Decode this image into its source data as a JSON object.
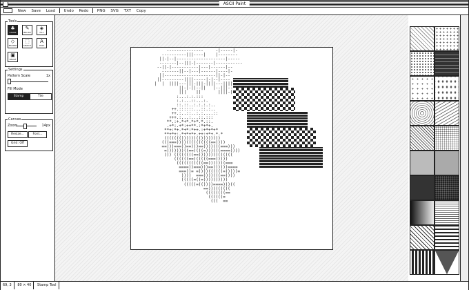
{
  "app": {
    "title": "ASCII Paint"
  },
  "menu": {
    "items": [
      "New",
      "Save",
      "Load",
      "Undo",
      "Redo",
      "PNG",
      "SVG",
      "TXT",
      "Copy"
    ]
  },
  "tools": {
    "label": "Tools",
    "items": [
      {
        "label": "STAMP",
        "icon": "stamp-icon",
        "glyph": "♣",
        "active": true
      },
      {
        "label": "BRUSH",
        "icon": "brush-icon",
        "glyph": "✎",
        "active": false
      },
      {
        "label": "FILL",
        "icon": "fill-icon",
        "glyph": "◈",
        "active": false
      },
      {
        "label": "ERASER",
        "icon": "eraser-icon",
        "glyph": "◇",
        "active": false
      },
      {
        "label": "SELECT",
        "icon": "select-icon",
        "glyph": "⬚",
        "active": false
      },
      {
        "label": "TEXT",
        "icon": "text-icon",
        "glyph": "A",
        "active": false
      },
      {
        "label": "IMAGE",
        "icon": "image-icon",
        "glyph": "▣",
        "active": false
      }
    ]
  },
  "settings": {
    "label": "Settings",
    "pattern_scale_label": "Pattern Scale",
    "pattern_scale_value": "1x",
    "fill_mode_label": "Fill Mode",
    "stamp_label": "Stamp",
    "tile_label": "Tile",
    "fill_mode": "Stamp"
  },
  "canvas": {
    "label": "Canvas",
    "zoom_label": "Zoom",
    "zoom_value": "14px",
    "resize_label": "Resize...",
    "font_label": "Font...",
    "grid_label": "Grid: Off"
  },
  "status": {
    "coords": "69, 3",
    "size": "80 × 40",
    "tool": "Stamp Tool"
  },
  "patterns": [
    "dots-light",
    "diagonal-dots",
    "dots-grid",
    "brick",
    "sparse-dots",
    "scatter",
    "circles",
    "curve-lines",
    "diagonal-stripes",
    "fine-dots",
    "gray-solid",
    "gray-solid",
    "dark-solid",
    "dark-texture",
    "vertical-gradient",
    "horizontal-stripes",
    "diamonds",
    "wave-lines",
    "vertical-bars",
    "triangle",
    "crosshatch",
    "dark-noise"
  ],
  "colors": {
    "ink": "#222222",
    "paper": "#ffffff",
    "stage": "#f4f4f4"
  }
}
